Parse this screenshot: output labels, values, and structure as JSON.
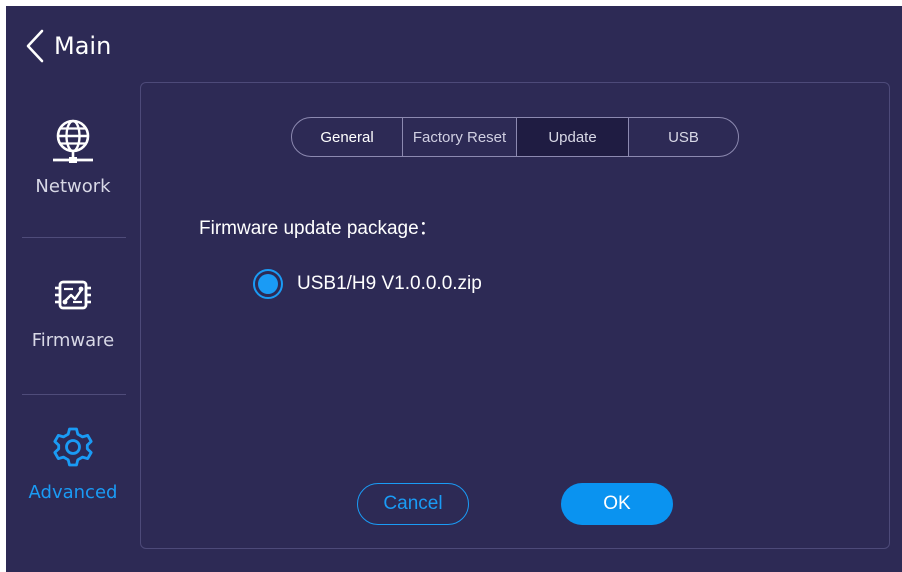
{
  "header": {
    "back_label": "Main",
    "back_icon": "chevron-left-icon"
  },
  "sidebar": {
    "items": [
      {
        "label": "Network",
        "icon": "globe-network-icon",
        "active": false
      },
      {
        "label": "Firmware",
        "icon": "firmware-chip-icon",
        "active": false
      },
      {
        "label": "Advanced",
        "icon": "gear-icon",
        "active": true
      }
    ]
  },
  "tabs": [
    {
      "label": "General",
      "selected": false
    },
    {
      "label": "Factory Reset",
      "selected": false
    },
    {
      "label": "Update",
      "selected": true
    },
    {
      "label": "USB",
      "selected": false
    }
  ],
  "update": {
    "section_label": "Firmware update package：",
    "packages": [
      {
        "label": "USB1/H9 V1.0.0.0.zip",
        "selected": true
      }
    ]
  },
  "buttons": {
    "cancel_label": "Cancel",
    "ok_label": "OK"
  },
  "colors": {
    "background": "#2d2a55",
    "accent": "#1a9bf5",
    "tab_selected_bg": "#1f1c42",
    "border": "#4d4a79"
  }
}
